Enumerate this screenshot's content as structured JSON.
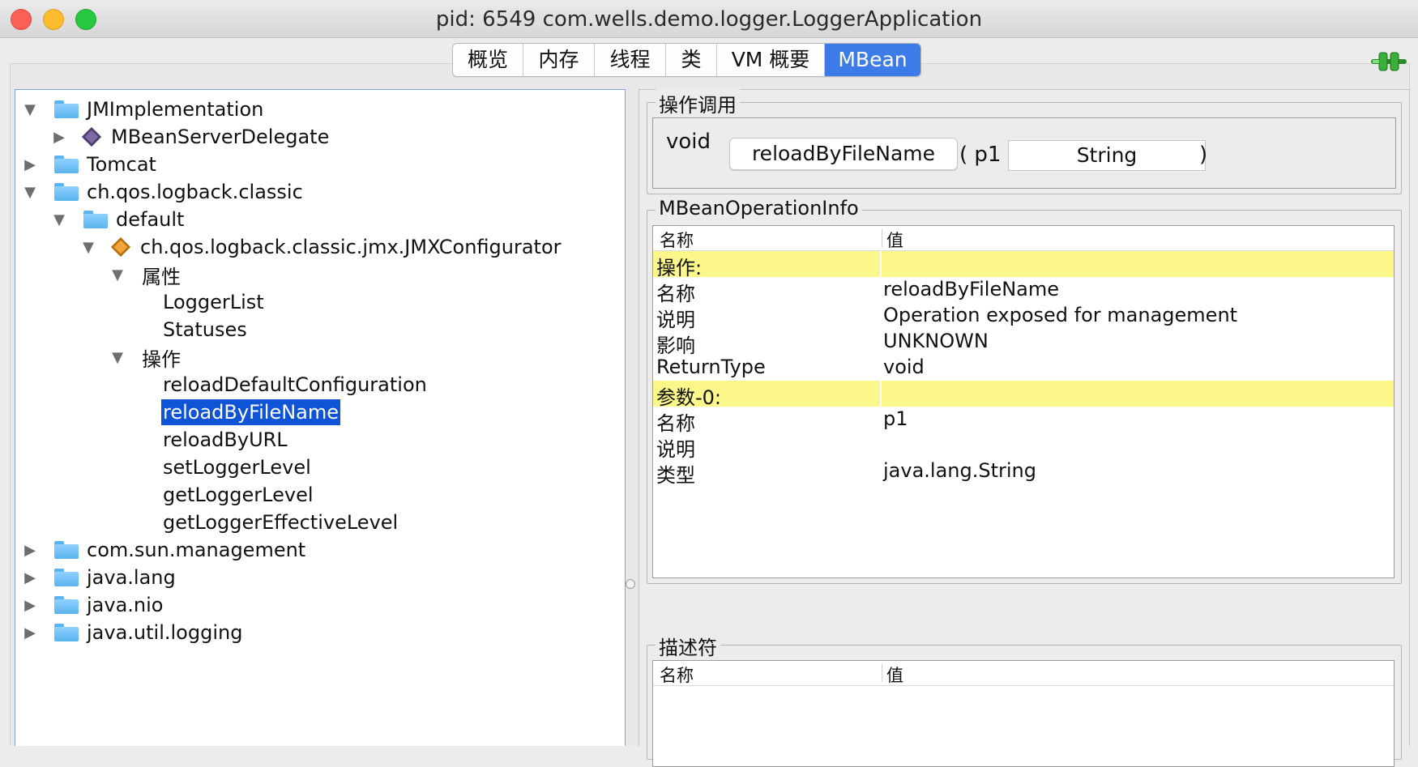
{
  "window": {
    "title": "pid: 6549 com.wells.demo.logger.LoggerApplication"
  },
  "tabs": [
    {
      "label": "概览",
      "active": false
    },
    {
      "label": "内存",
      "active": false
    },
    {
      "label": "线程",
      "active": false
    },
    {
      "label": "类",
      "active": false
    },
    {
      "label": "VM 概要",
      "active": false
    },
    {
      "label": "MBean",
      "active": true
    }
  ],
  "tree": {
    "nodes": [
      {
        "label": "JMImplementation",
        "icon": "folder-icon",
        "expanded": true
      },
      {
        "label": "MBeanServerDelegate",
        "icon": "mbean-icon",
        "expanded": false
      },
      {
        "label": "Tomcat",
        "icon": "folder-icon",
        "expanded": false
      },
      {
        "label": "ch.qos.logback.classic",
        "icon": "folder-icon",
        "expanded": true
      },
      {
        "label": "default",
        "icon": "folder-icon",
        "expanded": true
      },
      {
        "label": "ch.qos.logback.classic.jmx.JMXConfigurator",
        "icon": "mbean-icon",
        "expanded": true
      },
      {
        "label": "属性",
        "expanded": true
      },
      {
        "label": "LoggerList"
      },
      {
        "label": "Statuses"
      },
      {
        "label": "操作",
        "expanded": true
      },
      {
        "label": "reloadDefaultConfiguration"
      },
      {
        "label": "reloadByFileName",
        "selected": true
      },
      {
        "label": "reloadByURL"
      },
      {
        "label": "setLoggerLevel"
      },
      {
        "label": "getLoggerLevel"
      },
      {
        "label": "getLoggerEffectiveLevel"
      },
      {
        "label": "com.sun.management",
        "icon": "folder-icon",
        "expanded": false
      },
      {
        "label": "java.lang",
        "icon": "folder-icon",
        "expanded": false
      },
      {
        "label": "java.nio",
        "icon": "folder-icon",
        "expanded": false
      },
      {
        "label": "java.util.logging",
        "icon": "folder-icon",
        "expanded": false
      }
    ]
  },
  "operation_invocation": {
    "title": "操作调用",
    "return_type": "void",
    "operation_button": "reloadByFileName",
    "open_paren": "( p1",
    "param_value": "String",
    "close_paren": ")"
  },
  "operation_info": {
    "title": "MBeanOperationInfo",
    "header": {
      "name": "名称",
      "value": "值"
    },
    "rows": [
      {
        "name": "操作:",
        "value": "",
        "highlight": true
      },
      {
        "name": "名称",
        "value": "reloadByFileName"
      },
      {
        "name": "说明",
        "value": "Operation exposed for management"
      },
      {
        "name": "影响",
        "value": "UNKNOWN"
      },
      {
        "name": "ReturnType",
        "value": "void"
      },
      {
        "name": "参数-0:",
        "value": "",
        "highlight": true
      },
      {
        "name": "名称",
        "value": "p1"
      },
      {
        "name": "说明",
        "value": ""
      },
      {
        "name": "类型",
        "value": "java.lang.String"
      }
    ]
  },
  "descriptor": {
    "title": "描述符",
    "header": {
      "name": "名称",
      "value": "值"
    }
  },
  "colors": {
    "selection": "#0f53d6",
    "active_tab": "#3d7ce8",
    "highlight_row": "#fbf78a",
    "connected_icon": "#3ab03a"
  }
}
